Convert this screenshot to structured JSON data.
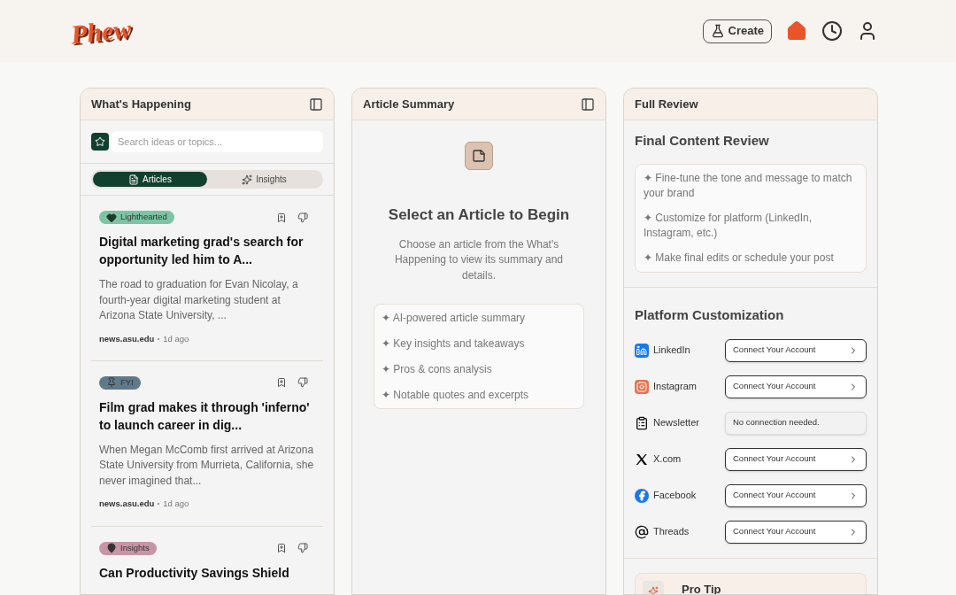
{
  "header": {
    "logo": "Phew",
    "create_label": "Create",
    "nav": [
      {
        "kind": "home",
        "selected": true
      },
      {
        "kind": "clock",
        "selected": false
      },
      {
        "kind": "user",
        "selected": false
      }
    ]
  },
  "feed": {
    "title": "What's Happening",
    "search": {
      "placeholder": "Search ideas or topics..."
    },
    "tabs": [
      {
        "label": "Articles",
        "kind": "articles",
        "selected": true
      },
      {
        "label": "Insights",
        "kind": "insights",
        "selected": false
      }
    ],
    "articles": [
      {
        "tag": {
          "label": "Lighthearted",
          "kind": "heart",
          "color": "#7cc4a4"
        },
        "title": "Digital marketing grad's search for opportunity led him to A...",
        "excerpt": "The road to graduation for Evan Nicolay, a fourth-year digital marketing student at Arizona State University, ...",
        "source": "news.asu.edu",
        "time": "1d ago"
      },
      {
        "tag": {
          "label": "FYI",
          "kind": "pin",
          "color": "#5f7a8a"
        },
        "title": "Film grad makes it through 'inferno' to launch career in dig...",
        "excerpt": "When Megan McComb first arrived at Arizona State University from Murrieta, California, she never imagined that...",
        "source": "news.asu.edu",
        "time": "1d ago"
      },
      {
        "tag": {
          "label": "Insights",
          "kind": "location",
          "color": "#c795a5"
        },
        "title": "Can Productivity Savings Shield"
      }
    ]
  },
  "summary": {
    "title": "Article Summary",
    "heading": "Select an Article to Begin",
    "text": "Choose an article from the What's Happening to view its summary and details.",
    "features": [
      "✦ AI-powered article summary",
      "✦ Key insights and takeaways",
      "✦ Pros & cons analysis",
      "✦ Notable quotes and excerpts"
    ]
  },
  "review": {
    "title": "Full Review",
    "heading": "Final Content Review",
    "points": [
      "✦ Fine-tune the tone and message to match your brand",
      "✦ Customize for platform (LinkedIn, Instagram, etc.)",
      "✦ Make final edits or schedule your post"
    ],
    "platform_heading": "Platform Customization",
    "platforms": [
      {
        "name": "LinkedIn",
        "kind": "linkedin",
        "action": {
          "kind": "button",
          "label": "Connect Your Account"
        }
      },
      {
        "name": "Instagram",
        "kind": "instagram",
        "action": {
          "kind": "button",
          "label": "Connect Your Account"
        }
      },
      {
        "name": "Newsletter",
        "kind": "newsletter",
        "action": {
          "kind": "note",
          "label": "No connection needed."
        }
      },
      {
        "name": "X.com",
        "kind": "x",
        "action": {
          "kind": "button",
          "label": "Connect Your Account"
        }
      },
      {
        "name": "Facebook",
        "kind": "facebook",
        "action": {
          "kind": "button",
          "label": "Connect Your Account"
        }
      },
      {
        "name": "Threads",
        "kind": "threads",
        "action": {
          "kind": "button",
          "label": "Connect Your Account"
        }
      }
    ],
    "tip_title": "Pro Tip"
  }
}
